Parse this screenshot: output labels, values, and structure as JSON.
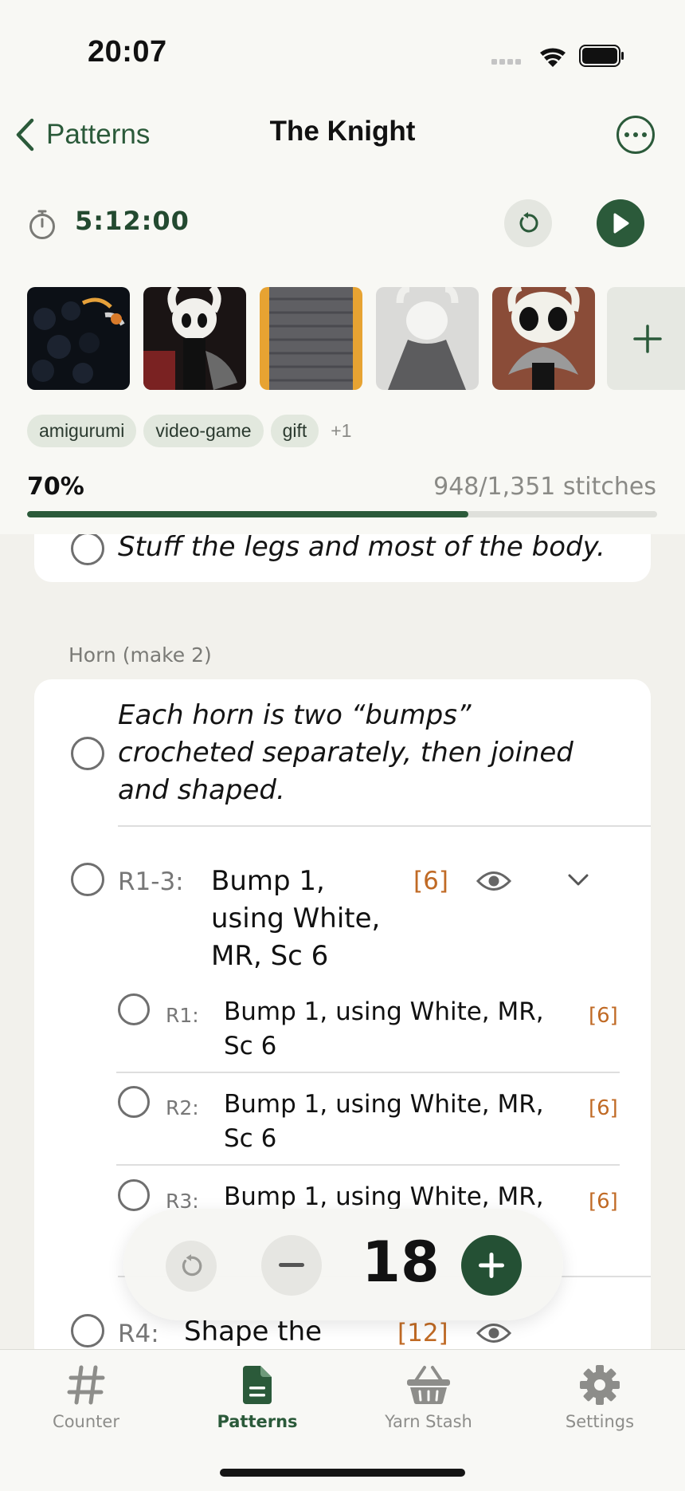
{
  "status_bar": {
    "time": "20:07"
  },
  "nav": {
    "back_label": "Patterns",
    "title": "The Knight"
  },
  "timer": {
    "value": "5:12:00"
  },
  "photos": [
    {
      "name": "photo-1"
    },
    {
      "name": "photo-2"
    },
    {
      "name": "photo-3"
    },
    {
      "name": "photo-4"
    },
    {
      "name": "photo-5"
    }
  ],
  "tags": {
    "items": [
      "amigurumi",
      "video-game",
      "gift"
    ],
    "more": "+1"
  },
  "progress": {
    "percent_label": "70%",
    "stitches_label": "948/1,351 stitches",
    "fraction": 0.7
  },
  "content": {
    "prev_step_text": "Stuff the legs and most of the body.",
    "section_title": "Horn (make 2)",
    "intro_text_lines": [
      "Each horn is two “bumps”",
      "crocheted separately, then joined",
      "and shaped."
    ],
    "group": {
      "label": "R1-3:",
      "text_lines": [
        "Bump 1,",
        "using White,",
        "MR, Sc 6"
      ],
      "count": "[6]"
    },
    "rows": [
      {
        "label": "R1:",
        "text_lines": [
          "Bump 1, using White, MR,",
          "Sc 6"
        ],
        "count": "[6]"
      },
      {
        "label": "R2:",
        "text_lines": [
          "Bump 1, using White, MR,",
          "Sc 6"
        ],
        "count": "[6]"
      },
      {
        "label": "R3:",
        "text_lines": [
          "Bump 1, using White, MR,"
        ],
        "count": "[6]"
      }
    ],
    "next_row": {
      "label": "R4:",
      "text": "Shape the",
      "count": "[12]"
    }
  },
  "counter": {
    "value": "18"
  },
  "tabbar": {
    "items": [
      {
        "label": "Counter",
        "icon": "hash-icon"
      },
      {
        "label": "Patterns",
        "icon": "document-icon"
      },
      {
        "label": "Yarn Stash",
        "icon": "basket-icon"
      },
      {
        "label": "Settings",
        "icon": "gear-icon"
      }
    ],
    "active": "Patterns"
  },
  "colors": {
    "accent": "#2b5a3a",
    "count": "#c06a25"
  }
}
